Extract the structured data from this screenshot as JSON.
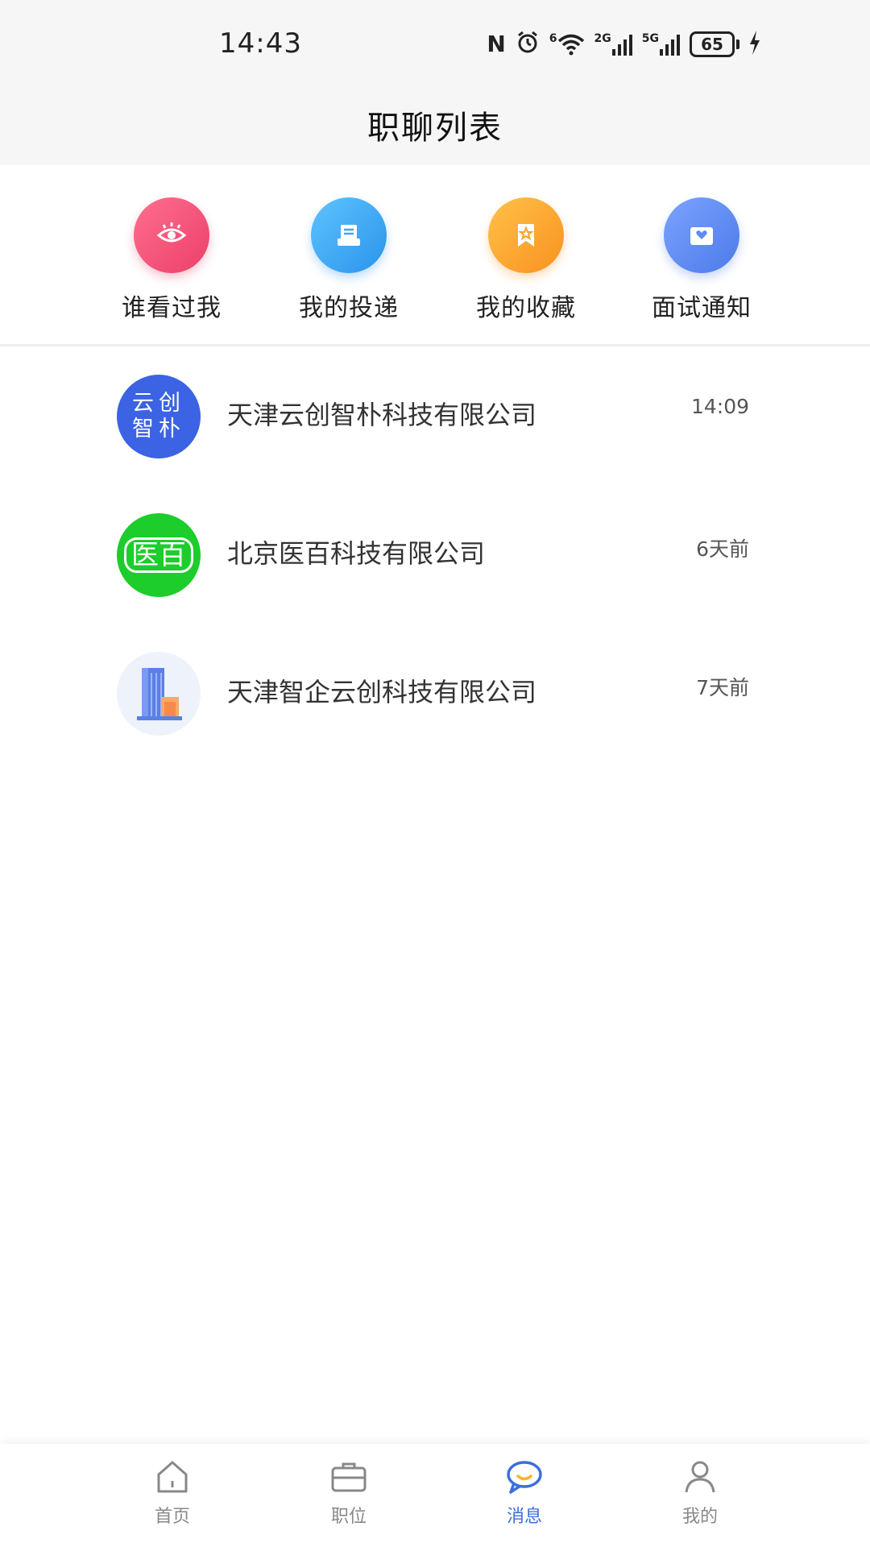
{
  "status_bar": {
    "time": "14:43",
    "nfc": "N",
    "wifi_badge": "6",
    "sim1": "2G",
    "sim2": "5G",
    "battery": "65"
  },
  "header": {
    "title": "职聊列表"
  },
  "quick_actions": [
    {
      "label": "谁看过我",
      "icon": "eye-icon",
      "color": "#f2547a"
    },
    {
      "label": "我的投递",
      "icon": "document-icon",
      "color": "#3ba7ef"
    },
    {
      "label": "我的收藏",
      "icon": "bookmark-star-icon",
      "color": "#fba42a"
    },
    {
      "label": "面试通知",
      "icon": "envelope-heart-icon",
      "color": "#5f8def"
    }
  ],
  "chats": [
    {
      "company": "天津云创智朴科技有限公司",
      "time": "14:09",
      "avatar_text_1": "云创",
      "avatar_text_2": "智朴",
      "avatar_color": "#3b63e3"
    },
    {
      "company": "北京医百科技有限公司",
      "time": "6天前",
      "avatar_text": "医百",
      "avatar_color": "#1ccd2c"
    },
    {
      "company": "天津智企云创科技有限公司",
      "time": "7天前",
      "avatar_icon": "building-icon",
      "avatar_color": "#eef2fb"
    }
  ],
  "tabs": [
    {
      "label": "首页",
      "icon": "home-icon"
    },
    {
      "label": "职位",
      "icon": "briefcase-icon"
    },
    {
      "label": "消息",
      "icon": "chat-bubble-icon",
      "active": true
    },
    {
      "label": "我的",
      "icon": "person-icon"
    }
  ],
  "colors": {
    "accent": "#3d6fd9",
    "tab_inactive": "#888888"
  }
}
